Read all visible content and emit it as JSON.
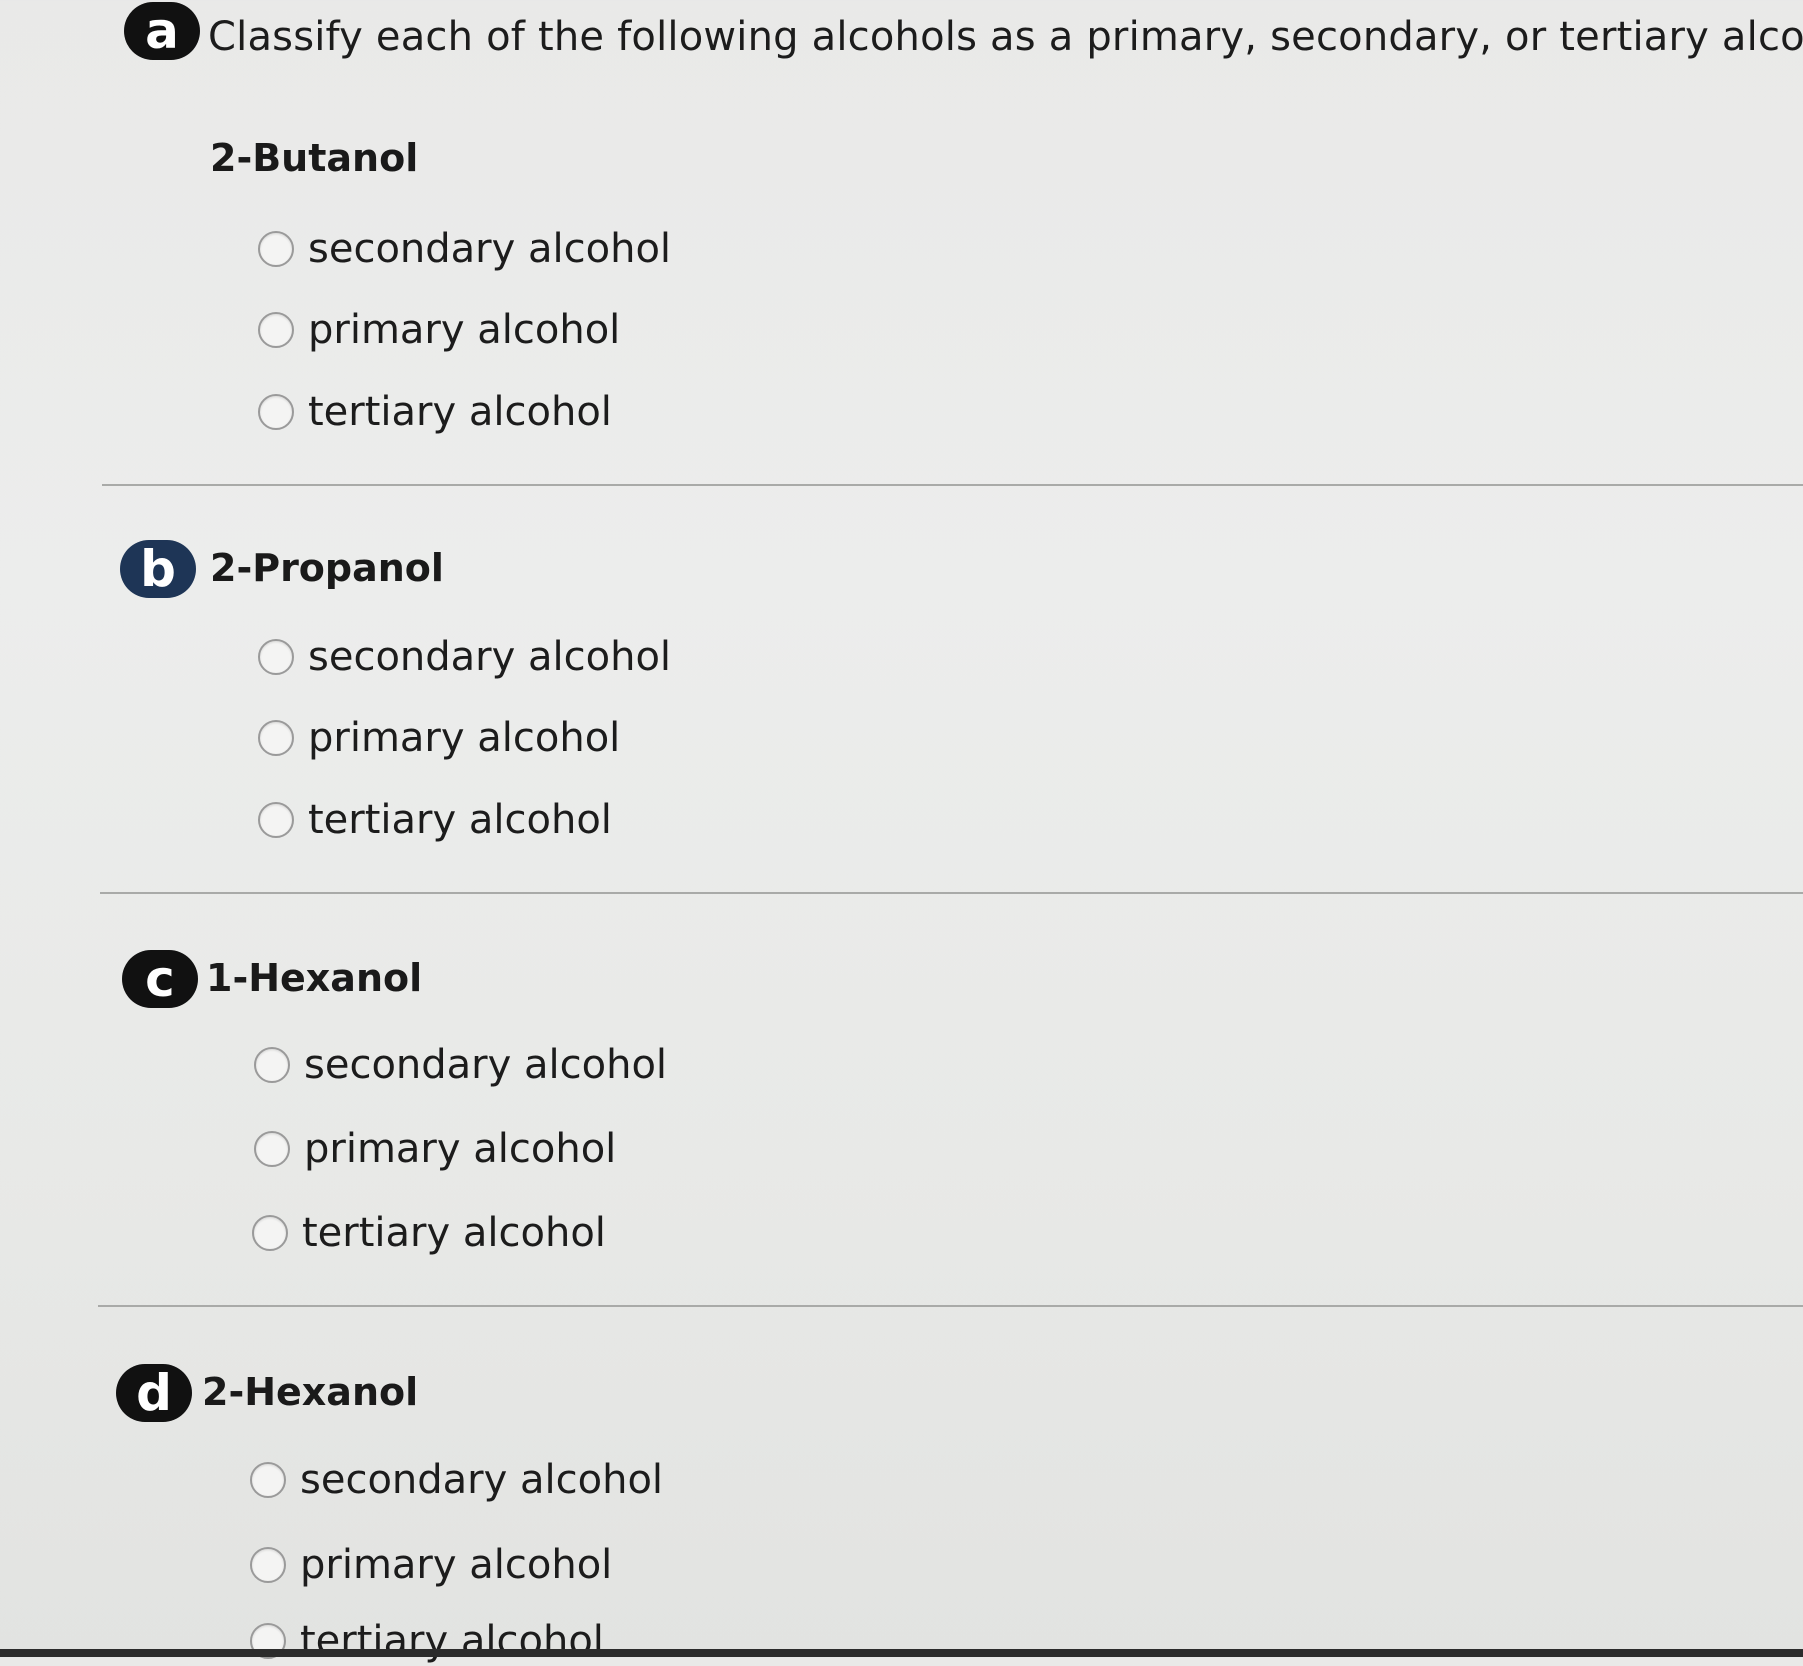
{
  "prompt": "Classify each of the following alcohols as a primary, secondary, or tertiary alcohol.",
  "questions": [
    {
      "badge": "a",
      "title": "2-Butanol",
      "options": [
        "secondary alcohol",
        "primary alcohol",
        "tertiary alcohol"
      ]
    },
    {
      "badge": "b",
      "title": "2-Propanol",
      "options": [
        "secondary alcohol",
        "primary alcohol",
        "tertiary alcohol"
      ]
    },
    {
      "badge": "c",
      "title": "1-Hexanol",
      "options": [
        "secondary alcohol",
        "primary alcohol",
        "tertiary alcohol"
      ]
    },
    {
      "badge": "d",
      "title": "2-Hexanol",
      "options": [
        "secondary alcohol",
        "primary alcohol",
        "tertiary alcohol"
      ]
    }
  ]
}
